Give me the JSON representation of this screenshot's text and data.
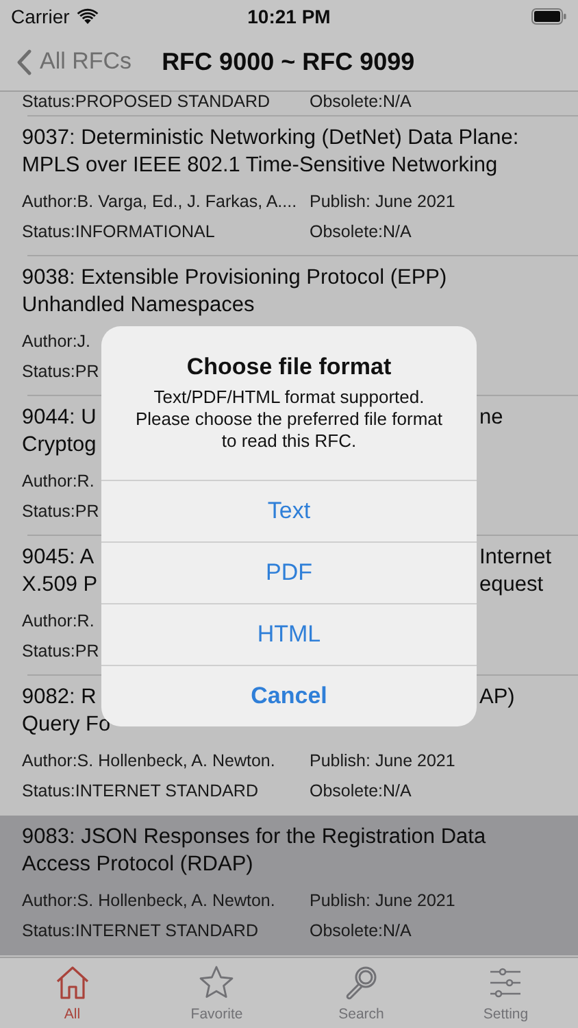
{
  "status_bar": {
    "carrier": "Carrier",
    "time": "10:21 PM"
  },
  "nav": {
    "back": "All RFCs",
    "title": "RFC 9000 ~ RFC 9099"
  },
  "rows": [
    {
      "status": "Status:PROPOSED STANDARD",
      "obsolete": "Obsolete:N/A",
      "selected": false
    },
    {
      "title_lines": [
        {
          "text": "9037: Deterministic Networking (DetNet) Data Plane:"
        },
        {
          "text": "MPLS over IEEE 802.1 Time-Sensitive Networking"
        }
      ],
      "author": "Author:B. Varga, Ed., J. Farkas, A....",
      "publish": "Publish: June 2021",
      "status": "Status:INFORMATIONAL",
      "obsolete": "Obsolete:N/A",
      "selected": false
    },
    {
      "title_lines": [
        {
          "text": "9038: Extensible Provisioning Protocol (EPP)"
        },
        {
          "text": "Unhandled Namespaces"
        }
      ],
      "author": "Author:J.",
      "status": "Status:PR",
      "selected": false
    },
    {
      "title_lines": [
        {
          "text": "9044: U",
          "tail": "ne"
        },
        {
          "text": "Cryptog"
        }
      ],
      "author": "Author:R.",
      "status": "Status:PR",
      "selected": false
    },
    {
      "title_lines": [
        {
          "text": "9045: A",
          "tail": "Internet"
        },
        {
          "text": "X.509 P",
          "tail": "equest"
        }
      ],
      "author": "Author:R.",
      "status": "Status:PR",
      "selected": false
    },
    {
      "title_lines": [
        {
          "text": "9082: R",
          "tail": "AP)"
        },
        {
          "text": "Query Fo"
        }
      ],
      "author": "Author:S. Hollenbeck, A. Newton.",
      "publish": "Publish: June 2021",
      "status": "Status:INTERNET STANDARD",
      "obsolete": "Obsolete:N/A",
      "selected": false
    },
    {
      "title_lines": [
        {
          "text": "9083: JSON Responses for the Registration Data"
        },
        {
          "text": "Access Protocol (RDAP)"
        }
      ],
      "author": "Author:S. Hollenbeck, A. Newton.",
      "publish": "Publish: June 2021",
      "status": "Status:INTERNET STANDARD",
      "obsolete": "Obsolete:N/A",
      "selected": true
    }
  ],
  "dialog": {
    "title": "Choose file format",
    "message": "Text/PDF/HTML format supported. Please choose the preferred file format to read this RFC.",
    "actions": [
      {
        "label": "Text",
        "kind": "default"
      },
      {
        "label": "PDF",
        "kind": "default"
      },
      {
        "label": "HTML",
        "kind": "default"
      },
      {
        "label": "Cancel",
        "kind": "cancel"
      }
    ]
  },
  "tabs": [
    {
      "label": "All",
      "kind": "house",
      "selected": true
    },
    {
      "label": "Favorite",
      "kind": "star",
      "selected": false
    },
    {
      "label": "Search",
      "kind": "search",
      "selected": false
    },
    {
      "label": "Setting",
      "kind": "sliders",
      "selected": false
    }
  ]
}
